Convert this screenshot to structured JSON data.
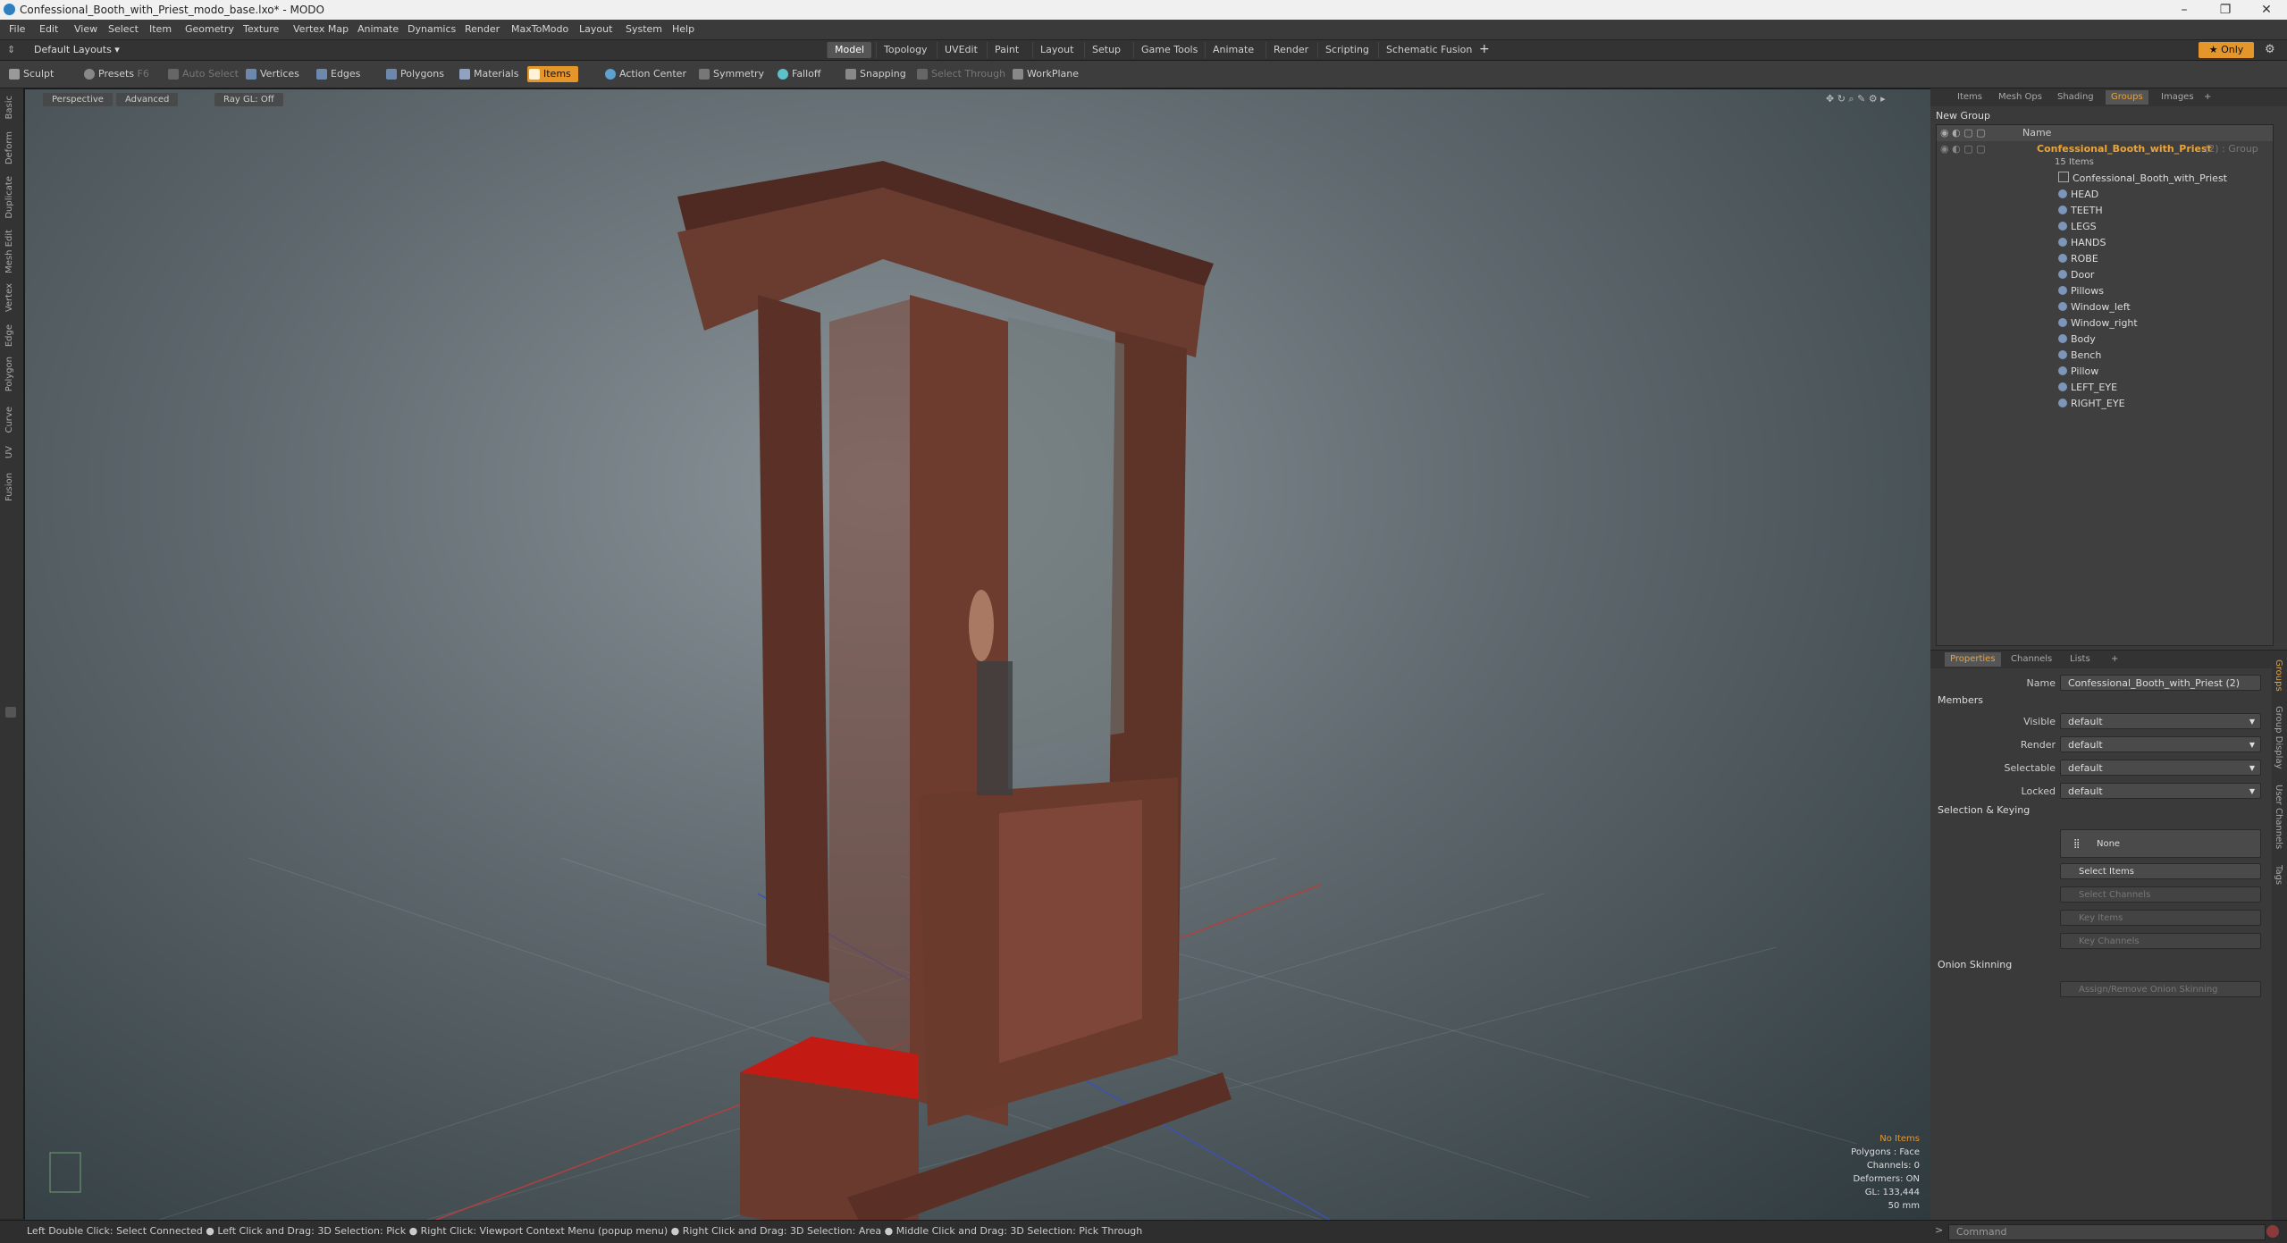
{
  "window": {
    "title": "Confessional_Booth_with_Priest_modo_base.lxo* - MODO",
    "controls": [
      "–",
      "❐",
      "✕"
    ]
  },
  "menu": [
    "File",
    "Edit",
    "View",
    "Select",
    "Item",
    "Geometry",
    "Texture",
    "Vertex Map",
    "Animate",
    "Dynamics",
    "Render",
    "MaxToModo",
    "Layout",
    "System",
    "Help"
  ],
  "layoutbar": {
    "layouts_label": "Default Layouts ▾",
    "tabs": [
      "Model",
      "Topology",
      "UVEdit",
      "Paint",
      "Layout",
      "Setup",
      "Game Tools",
      "Animate",
      "Render",
      "Scripting",
      "Schematic Fusion"
    ],
    "add": "+",
    "only": "★ Only",
    "gear": "⚙"
  },
  "toolbar": {
    "sculpt": "Sculpt",
    "presets": "Presets",
    "presets_key": "F6",
    "auto_select": "Auto Select",
    "vertices": "Vertices",
    "edges": "Edges",
    "polygons": "Polygons",
    "materials": "Materials",
    "items": "Items",
    "action_center": "Action Center",
    "symmetry": "Symmetry",
    "falloff": "Falloff",
    "snapping": "Snapping",
    "select_through": "Select Through",
    "workplane": "WorkPlane"
  },
  "leftstrip": [
    "Basic",
    "Deform",
    "Duplicate",
    "Mesh Edit",
    "Vertex",
    "Edge",
    "Polygon",
    "Curve",
    "UV",
    "Fusion"
  ],
  "viewport": {
    "perspective": "Perspective",
    "advanced": "Advanced",
    "raygl": "Ray GL: Off",
    "info": {
      "no_items": "No Items",
      "polygons": "Polygons : Face",
      "channels": "Channels: 0",
      "deformers": "Deformers: ON",
      "gl": "GL: 133,444",
      "mm": "50 mm"
    }
  },
  "status": {
    "text": "Left Double Click: Select Connected ● Left Click and Drag: 3D Selection: Pick ● Right Click: Viewport Context Menu (popup menu) ● Right Click and Drag: 3D Selection: Area ● Middle Click and Drag: 3D Selection: Pick Through",
    "command_placeholder": "Command"
  },
  "panel_tabs": [
    "Items",
    "Mesh Ops",
    "Shading",
    "Groups",
    "Images",
    "+"
  ],
  "groups": {
    "new_group": "New Group",
    "name_header": "Name",
    "group_name": "Confessional_Booth_with_Priest",
    "group_suffix": "(2) : Group",
    "item_count": "15 Items",
    "items": [
      "Confessional_Booth_with_Priest",
      "HEAD",
      "TEETH",
      "LEGS",
      "HANDS",
      "ROBE",
      "Door",
      "Pillows",
      "Window_left",
      "Window_right",
      "Body",
      "Bench",
      "Pillow",
      "LEFT_EYE",
      "RIGHT_EYE"
    ]
  },
  "props_tabs": [
    "Properties",
    "Channels",
    "Lists",
    "+"
  ],
  "properties": {
    "name_label": "Name",
    "name_value": "Confessional_Booth_with_Priest (2)",
    "members": "Members",
    "visible_label": "Visible",
    "render_label": "Render",
    "selectable_label": "Selectable",
    "locked_label": "Locked",
    "default_value": "default",
    "sel_keying": "Selection & Keying",
    "none": "None",
    "select_items": "Select Items",
    "select_channels": "Select Channels",
    "key_items": "Key Items",
    "key_channels": "Key Channels",
    "onion": "Onion Skinning",
    "assign_onion": "Assign/Remove Onion Skinning"
  },
  "props_vtabs": [
    "Groups",
    "Group Display",
    "User Channels",
    "Tags"
  ],
  "colors": {
    "accent": "#e5962a",
    "group_name": "#e9a43a",
    "wood": "#6b3a2e",
    "cushion": "#c41a14"
  }
}
